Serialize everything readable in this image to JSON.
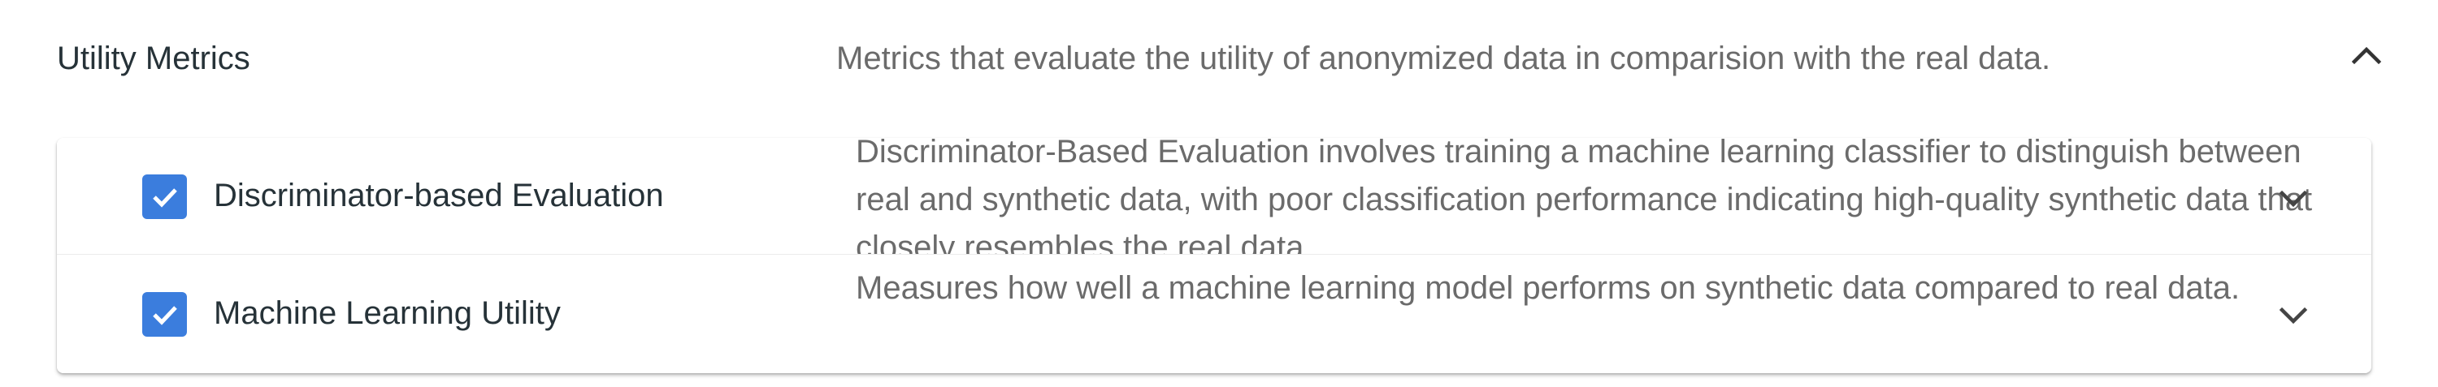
{
  "section": {
    "title": "Utility Metrics",
    "description": "Metrics that evaluate the utility of anonymized data in comparision with the real data.",
    "collapse_icon": "chevron-up-icon"
  },
  "metrics": [
    {
      "label": "Discriminator-based Evaluation",
      "checked": true,
      "description": "Discriminator-Based Evaluation involves training a machine learning classifier to distinguish between real and synthetic data, with poor classification performance indicating high-quality synthetic data that closely resembles the real data.",
      "expand_icon": "chevron-down-icon"
    },
    {
      "label": "Machine Learning Utility",
      "checked": true,
      "description": "Measures how well a machine learning model performs on synthetic data compared to real data.",
      "expand_icon": "chevron-down-icon"
    }
  ],
  "colors": {
    "checkbox": "#3b7ddd",
    "title_text": "#263238",
    "secondary_text": "#6b6b6b"
  }
}
